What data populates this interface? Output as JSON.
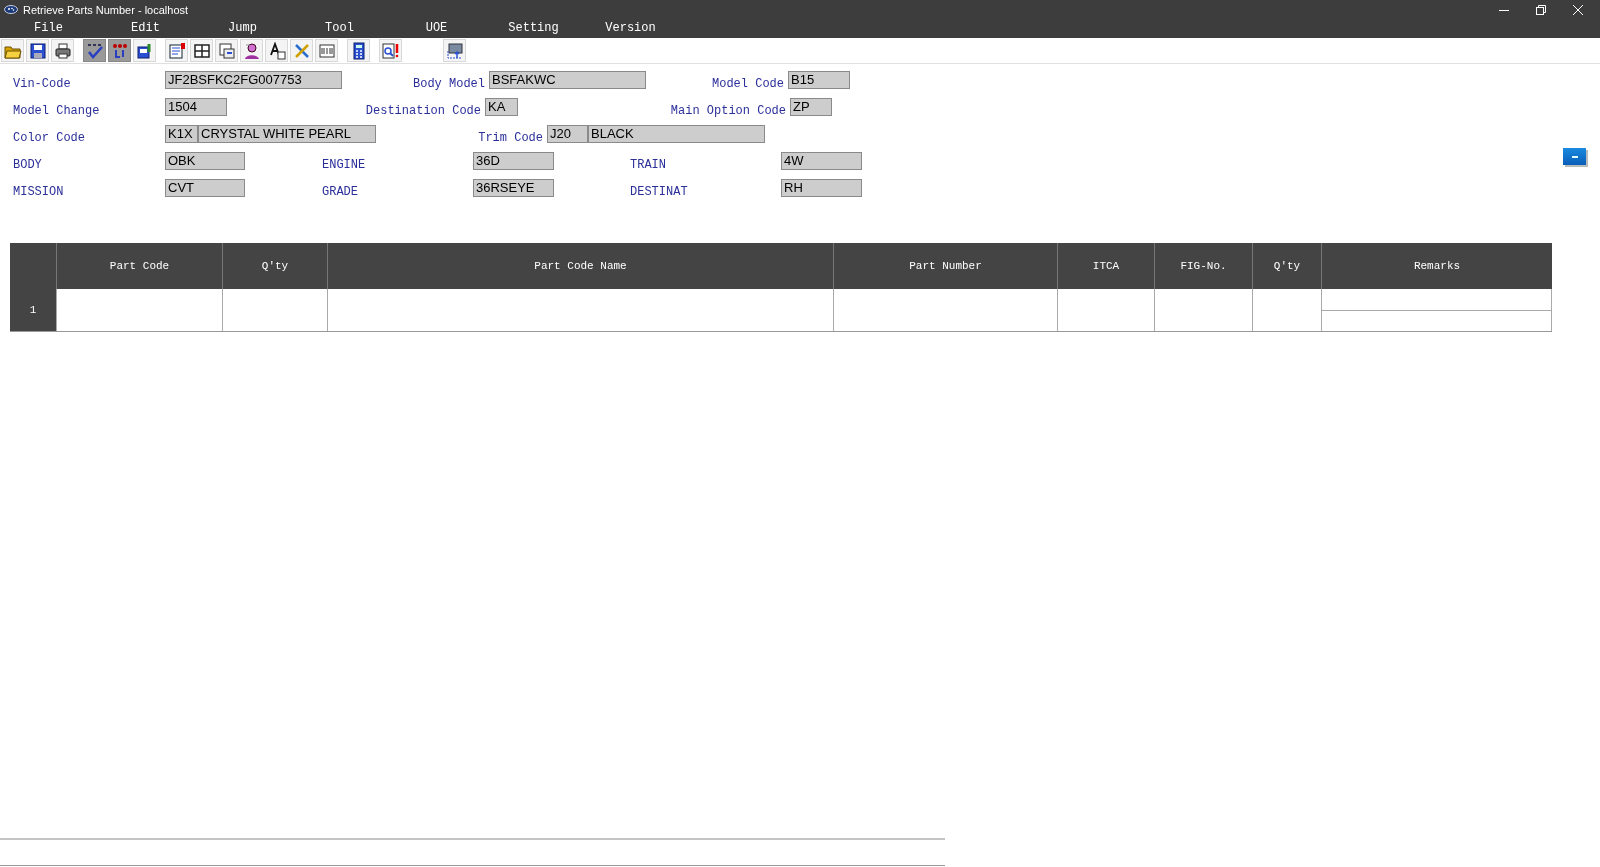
{
  "window": {
    "title": "Retrieve Parts Number - localhost"
  },
  "menu": [
    "File",
    "Edit",
    "Jump",
    "Tool",
    "UOE",
    "Setting",
    "Version"
  ],
  "toolbar": [
    [
      {
        "kind": "open",
        "pressed": false
      },
      {
        "kind": "save",
        "pressed": false
      },
      {
        "kind": "print",
        "pressed": false
      }
    ],
    [
      {
        "kind": "check",
        "pressed": true
      },
      {
        "kind": "swap",
        "pressed": true
      },
      {
        "kind": "export",
        "pressed": false
      }
    ],
    [
      {
        "kind": "report",
        "pressed": false
      },
      {
        "kind": "grid",
        "pressed": false
      },
      {
        "kind": "figure",
        "pressed": false
      },
      {
        "kind": "person",
        "pressed": false
      },
      {
        "kind": "font",
        "pressed": false
      },
      {
        "kind": "tools",
        "pressed": false
      },
      {
        "kind": "chart",
        "pressed": false
      }
    ],
    [
      {
        "kind": "calc",
        "pressed": false
      }
    ],
    [
      {
        "kind": "alert",
        "pressed": false
      }
    ],
    [
      {
        "kind": "window",
        "pressed": false
      }
    ]
  ],
  "form": {
    "rows": [
      [
        {
          "label": "Vin-Code",
          "values": [
            "JF2BSFKC2FG007753"
          ]
        },
        {
          "label": "Body Model",
          "values": [
            "BSFAKWC"
          ]
        },
        {
          "label": "Model Code",
          "values": [
            "B15"
          ]
        }
      ],
      [
        {
          "label": "Model Change",
          "values": [
            "1504"
          ]
        },
        {
          "label": "Destination Code",
          "values": [
            "KA"
          ]
        },
        {
          "label": "Main Option Code",
          "values": [
            "ZP"
          ]
        }
      ],
      [
        {
          "label": "Color Code",
          "values": [
            "K1X",
            "CRYSTAL WHITE PEARL"
          ]
        },
        {
          "label": "Trim Code",
          "values": [
            "J20",
            "BLACK"
          ]
        }
      ],
      [
        {
          "label": "BODY",
          "values": [
            "OBK"
          ]
        },
        {
          "label": "ENGINE",
          "values": [
            "36D"
          ]
        },
        {
          "label": "TRAIN",
          "values": [
            "4W"
          ]
        }
      ],
      [
        {
          "label": "MISSION",
          "values": [
            "CVT"
          ]
        },
        {
          "label": "GRADE",
          "values": [
            "36RSEYE"
          ]
        },
        {
          "label": "DESTINAT",
          "values": [
            "RH"
          ]
        }
      ]
    ]
  },
  "table": {
    "columns": [
      "Part Code",
      "Q'ty",
      "Part Code Name",
      "Part Number",
      "ITCA",
      "FIG-No.",
      "Q'ty",
      "Remarks"
    ],
    "rows": [
      {
        "number": "1"
      }
    ]
  }
}
